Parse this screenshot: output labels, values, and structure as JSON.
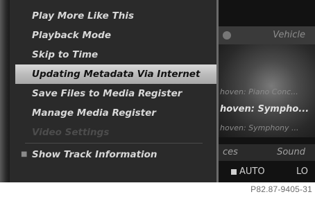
{
  "menu": {
    "items": [
      {
        "label": "Play More Like This"
      },
      {
        "label": "Playback Mode"
      },
      {
        "label": "Skip to Time"
      },
      {
        "label": "Updating Metadata Via Internet"
      },
      {
        "label": "Save Files to Media Register"
      },
      {
        "label": "Manage Media Register"
      },
      {
        "label": "Video Settings"
      },
      {
        "label": "Show Track Information"
      }
    ],
    "selected_index": 3,
    "disabled_index": 6
  },
  "background": {
    "header_label": "Vehicle",
    "tracks": [
      "hoven: Piano Conc...",
      "hoven: Sympho...",
      "hoven: Symphony ..."
    ],
    "tabs": {
      "left": "ces",
      "right": "Sound"
    },
    "status": {
      "auto": "AUTO",
      "right": "LO"
    }
  },
  "caption": "P82.87-9405-31",
  "colors": {
    "menu_bg": "#2a2a2a",
    "selected_bg": "#c4c4c4",
    "text": "#d8d8d8"
  }
}
